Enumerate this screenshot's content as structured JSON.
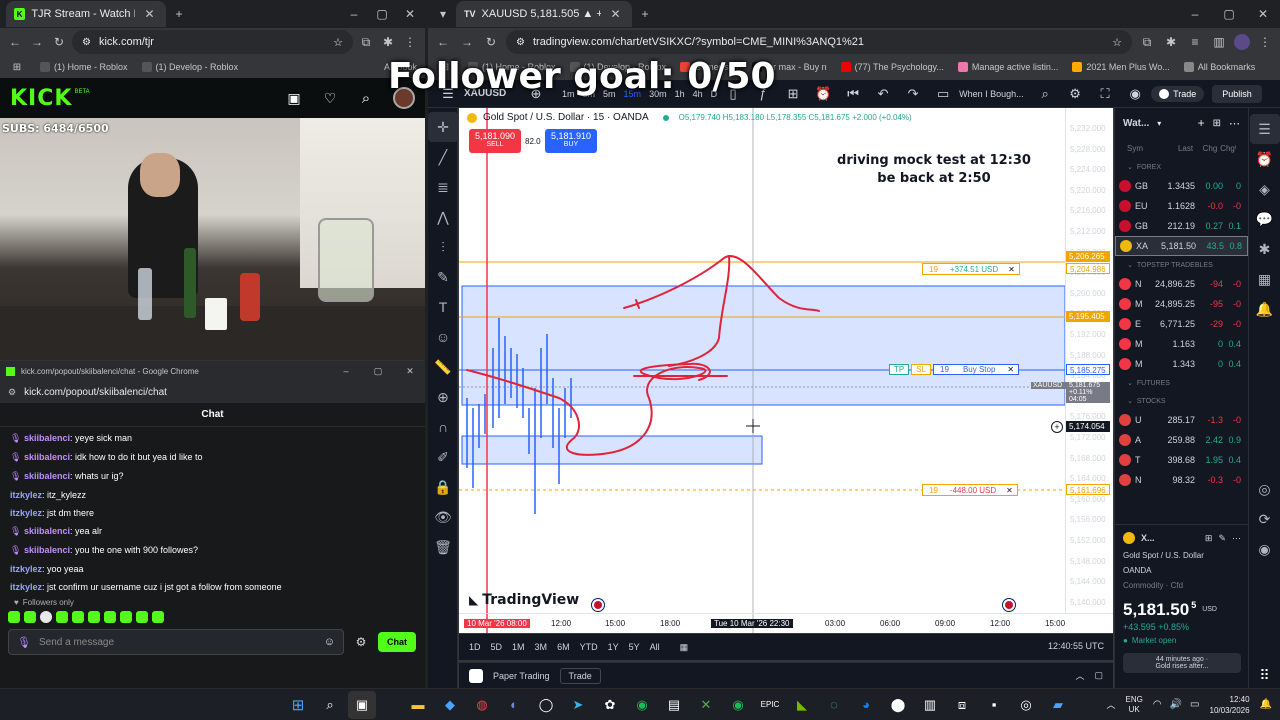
{
  "colors": {
    "kick_green": "#53fc18",
    "tv_blue": "#2962ff",
    "red": "#f23645",
    "green": "#22ab94"
  },
  "left_browser": {
    "tab_title": "TJR Stream - Watch Live on",
    "url": "kick.com/tjr",
    "bookmarks": [
      "(1) Home - Roblox",
      "(1) Develop - Roblox"
    ],
    "bookmarks_more": "All Book"
  },
  "kick": {
    "logo": "KICK",
    "logo_badge": "BETA",
    "subs": "SUBS: 6484/6500"
  },
  "overlay": {
    "follower_goal": "Follower goal: 0/50"
  },
  "chat_window": {
    "title": "kick.com/popout/skiibalenci/chat - Google Chrome",
    "url": "kick.com/popout/skiibalenci/chat",
    "header": "Chat",
    "messages": [
      {
        "user": "skiibalenci",
        "text": ": yeye sick man",
        "mod": true
      },
      {
        "user": "skiibalenci",
        "text": ": idk how to do it but yea id like to",
        "mod": true
      },
      {
        "user": "skiibalenci",
        "text": ": whats ur ig?",
        "mod": true
      },
      {
        "user": "itzkylez",
        "text": ": itz_kylezz",
        "mod": false
      },
      {
        "user": "itzkylez",
        "text": ": jst dm there",
        "mod": false
      },
      {
        "user": "skiibalenci",
        "text": ": yea alr",
        "mod": true
      },
      {
        "user": "skiibalenci",
        "text": ": you the one with 900 followes?",
        "mod": true
      },
      {
        "user": "itzkylez",
        "text": ": yoo yeaa",
        "mod": false
      },
      {
        "user": "itzkylez",
        "text": ": jst confirm ur username cuz i jst got a follow from someone",
        "mod": false
      }
    ],
    "followers_only": "Followers only",
    "input_placeholder": "Send a message",
    "send_label": "Chat"
  },
  "right_browser": {
    "tab_title": "XAUUSD 5,181.505 ▲ +0.85% U",
    "url": "tradingview.com/chart/etVSIKXC/?symbol=CME_MINI%3ANQ1%21",
    "bookmarks": [
      "(1) Home - Roblox",
      "(1) Develop - Roblox",
      "Gamer sch",
      "air max - Buy n",
      "(77) The Psychology...",
      "Manage active listin...",
      "2021 Men Plus Wo..."
    ],
    "bookmarks_more": "All Bookmarks"
  },
  "tv": {
    "symbol_short": "XAUUSD",
    "timeframes_top": [
      "1m",
      "3m",
      "5m",
      "15m",
      "30m",
      "1h",
      "4h",
      "D"
    ],
    "alert_label": "When I Bough...",
    "trade_label": "Trade",
    "publish_label": "Publish",
    "instrument": "Gold Spot / U.S. Dollar · 15 · OANDA",
    "ohlc": "O5,179.740 H5,183.180 L5,178.355 C5,181.675 +2.000 (+0.04%)",
    "sell_price": "5,181.090",
    "sell_label": "SELL",
    "spread": "82.0",
    "buy_price": "5,181.910",
    "buy_label": "BUY",
    "note_line1": "driving mock test at 12:30",
    "note_line2": "be back at 2:50",
    "price_axis": [
      "5,232.000",
      "5,228.000",
      "5,224.000",
      "5,220.000",
      "5,216.000",
      "5,212.000",
      "5,208.000",
      "5,204.000",
      "5,200.000",
      "5,196.000",
      "5,192.000",
      "5,188.000",
      "5,184.000",
      "5,180.000",
      "5,176.000",
      "5,172.000",
      "5,168.000",
      "5,164.000",
      "5,160.000",
      "5,156.000",
      "5,152.000",
      "5,148.000",
      "5,144.000",
      "5,140.000"
    ],
    "tags": {
      "p1": "5,206.265",
      "p2": "5,204.986",
      "p3": "5,195.405",
      "p4": "5,185.275",
      "p5": "5,181.675",
      "p5b": "+0.11%",
      "p5c": "04:05",
      "p6": "5,174.054",
      "p7": "5,161.696"
    },
    "orders": [
      {
        "qty": "19",
        "label": "+374.51 USD"
      },
      {
        "qty": "19",
        "label": "Buy Stop",
        "tp": "TP",
        "sl": "SL"
      },
      {
        "qty": "19",
        "label": "-448.00 USD"
      }
    ],
    "xaxis": [
      "10 Mar '26  08:00",
      "12:00",
      "15:00",
      "18:00",
      "Tue 10 Mar '26  22:30",
      "03:00",
      "06:00",
      "09:00",
      "12:00",
      "15:00"
    ],
    "ranges": [
      "1D",
      "5D",
      "1M",
      "3M",
      "6M",
      "YTD",
      "1Y",
      "5Y",
      "All"
    ],
    "clock": "12:40:55 UTC",
    "brand": "TradingView",
    "paper_trading": "Paper Trading",
    "trade_tab": "Trade",
    "watchlist": {
      "title": "Wat...",
      "cols": [
        "Sym",
        "Last",
        "Chg",
        "Chg%"
      ],
      "sections": [
        "FOREX",
        "TOPSTEP TRADEBLES",
        "FUTURES",
        "STOCKS"
      ],
      "forex": [
        {
          "sym": "GB",
          "last": "1.3435",
          "chg": "0.00",
          "pct": "0"
        },
        {
          "sym": "EU",
          "last": "1.1628",
          "chg": "-0.0",
          "pct": "-0"
        },
        {
          "sym": "GB",
          "last": "212.19",
          "chg": "0.27",
          "pct": "0.1"
        },
        {
          "sym": "XA",
          "last": "5,181.50",
          "chg": "43.5",
          "pct": "0.8"
        }
      ],
      "topstep": [
        {
          "sym": "N",
          "last": "24,896.25",
          "chg": "-94",
          "pct": "-0"
        },
        {
          "sym": "M",
          "last": "24,895.25",
          "chg": "-95",
          "pct": "-0"
        },
        {
          "sym": "E",
          "last": "6,771.25",
          "chg": "-29",
          "pct": "-0"
        },
        {
          "sym": "M",
          "last": "1.163",
          "chg": "0",
          "pct": "0.4"
        },
        {
          "sym": "M",
          "last": "1.343",
          "chg": "0",
          "pct": "0.4"
        }
      ],
      "stocks": [
        {
          "sym": "U",
          "last": "285.17",
          "chg": "-1.3",
          "pct": "-0"
        },
        {
          "sym": "A",
          "last": "259.88",
          "chg": "2.42",
          "pct": "0.9"
        },
        {
          "sym": "T",
          "last": "398.68",
          "chg": "1.95",
          "pct": "0.4"
        },
        {
          "sym": "N",
          "last": "98.32",
          "chg": "-0.3",
          "pct": "-0"
        }
      ],
      "detail_sym": "X...",
      "detail_name": "Gold Spot / U.S. Dollar",
      "detail_broker": "OANDA",
      "detail_type": "Commodity · Cfd",
      "detail_price": "5,181.50",
      "detail_price_sup": "5",
      "detail_ccy": "USD",
      "detail_change": "+43.595 +0.85%",
      "market_status": "Market open",
      "news_time": "44 minutes ago ·",
      "news_title": "Gold rises after..."
    }
  },
  "taskbar": {
    "lang1": "ENG",
    "lang2": "UK",
    "time": "12:40",
    "date": "10/03/2026"
  }
}
